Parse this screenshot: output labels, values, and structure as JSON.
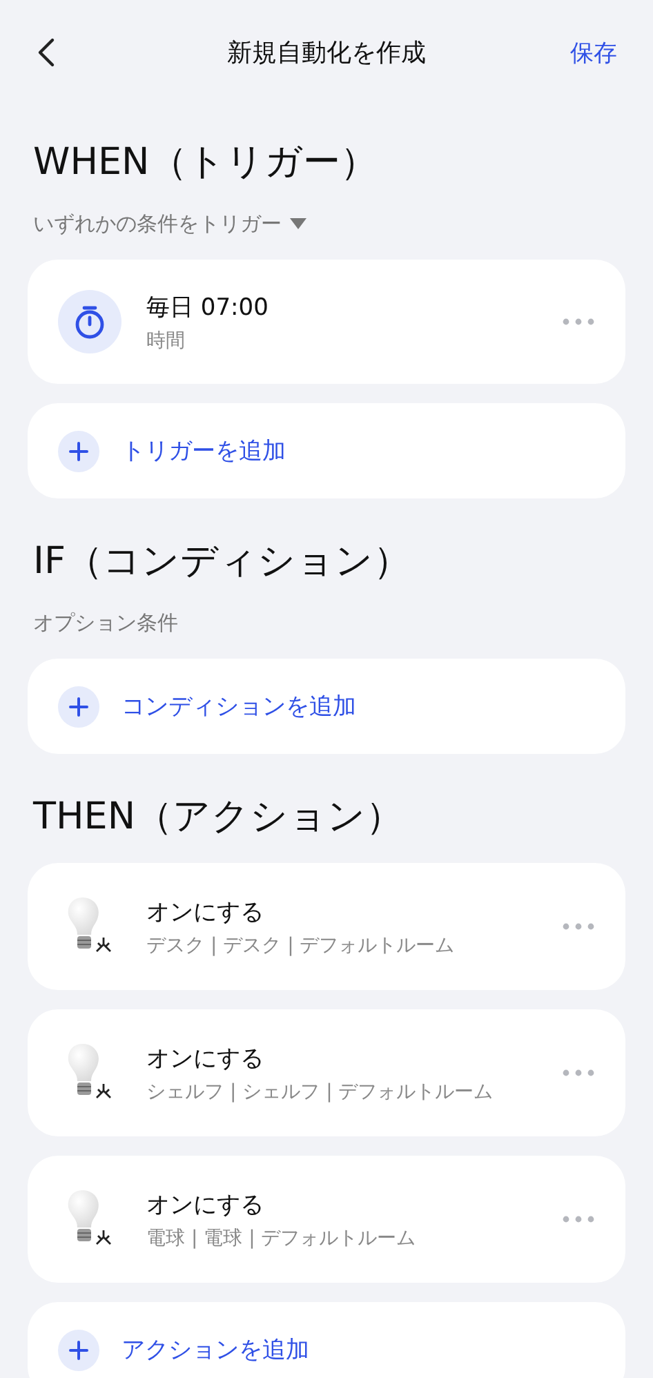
{
  "header": {
    "title": "新規自動化を作成",
    "save": "保存"
  },
  "sections": [
    {
      "title": "WHEN（トリガー）",
      "subtitle": {
        "kind": "dropdown",
        "text": "いずれかの条件をトリガー"
      },
      "items": [
        {
          "kind": "timer",
          "title": "毎日 07:00",
          "detail": "時間"
        }
      ],
      "add": "トリガーを追加"
    },
    {
      "title": "IF（コンディション）",
      "subtitle": {
        "kind": "note",
        "text": "オプション条件"
      },
      "add": "コンディションを追加"
    },
    {
      "title": "THEN（アクション）",
      "items": [
        {
          "kind": "bulb",
          "title": "オンにする",
          "detail": "デスク | デスク | デフォルトルーム"
        },
        {
          "kind": "bulb",
          "title": "オンにする",
          "detail": "シェルフ | シェルフ | デフォルトルーム"
        },
        {
          "kind": "bulb",
          "title": "オンにする",
          "detail": "電球 | 電球 | デフォルトルーム"
        }
      ],
      "add": "アクションを追加"
    }
  ]
}
